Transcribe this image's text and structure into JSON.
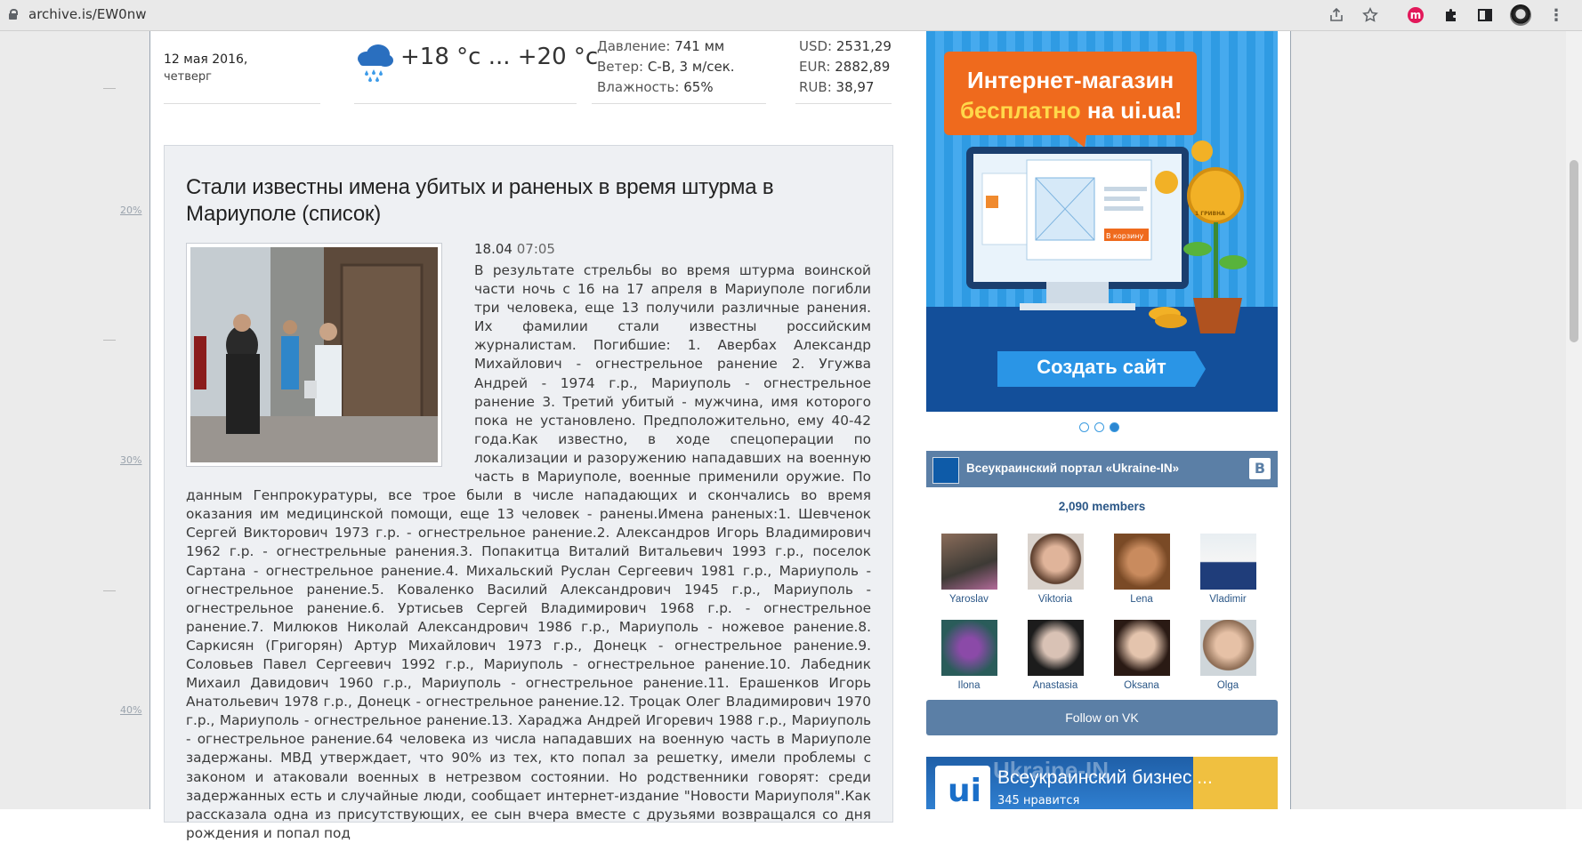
{
  "browser": {
    "url": "archive.is/EW0nw",
    "icons": [
      "share-icon",
      "star-icon",
      "extension-m-icon",
      "puzzle-icon",
      "sidebar-icon",
      "profile-avatar-icon",
      "more-menu-icon"
    ]
  },
  "ruler": {
    "labels": [
      "20%",
      "30%",
      "40%"
    ]
  },
  "header": {
    "date": "12 мая 2016,",
    "weekday": "четверг",
    "temperature": "+18 °с ... +20 °с",
    "weather": [
      {
        "label": "Давление:",
        "value": "741 мм"
      },
      {
        "label": "Ветер:",
        "value": "С-В, 3 м/сек."
      },
      {
        "label": "Влажность:",
        "value": "65%"
      }
    ],
    "currency": [
      {
        "label": "USD:",
        "value": "2531,29"
      },
      {
        "label": "EUR:",
        "value": "2882,89"
      },
      {
        "label": "RUB:",
        "value": "38,97"
      }
    ]
  },
  "article": {
    "title": "Стали известны имена убитых и раненых в время штурма в Мариуполе (список)",
    "date": "18.04",
    "time": "07:05",
    "body": "В результате стрельбы во время штурма воинской части ночь с 16 на 17 апреля в Мариуполе погибли три человека, еще 13 получили различные ранения. Их фамилии стали известны российским журналистам. Погибшие: 1. Авербах Александр Михайлович - огнестрельное ранение 2. Угужва Андрей - 1974 г.р., Мариуполь - огнестрельное ранение 3. Третий убитый - мужчина, имя которого пока не установлено. Предположительно, ему 40-42 года.Как известно, в ходе спецоперации по локализации и разоружению нападавших на военную часть в Мариуполе, военные применили оружие. По данным Генпрокуратуры, все трое были в числе нападающих и скончались во время оказания им медицинской помощи, еще 13 человек - ранены.Имена раненых:1. Шевченок Сергей Викторович 1973 г.р. - огнестрельное ранение.2. Александров Игорь Владимирович 1962 г.р. - огнестрельные ранения.3. Попакитца Виталий Витальевич 1993 г.р., поселок Сартана - огнестрельное ранение.4. Михальский Руслан Сергеевич 1981 г.р., Мариуполь - огнестрельное ранение.5. Коваленко Василий Александрович 1945 г.р., Мариуполь - огнестрельное ранение.6. Уртисьев Сергей Владимирович 1968 г.р. - огнестрельное ранение.7. Милюков Николай Александрович 1986 г.р., Мариуполь - ножевое ранение.8. Саркисян (Григорян) Артур Михайлович 1973 г.р., Донецк - огнестрельное ранение.9. Соловьев Павел Сергеевич 1992 г.р., Мариуполь - огнестрельное ранение.10. Лабедник Михаил Давидович 1960 г.р., Мариуполь - огнестрельное ранение.11. Ерашенков Игорь Анатольевич 1978 г.р., Донецк - огнестрельное ранение.12. Троцак Олег Владимирович 1970 г.р., Мариуполь - огнестрельное ранение.13. Хараджа Андрей Игоревич 1988 г.р., Мариуполь - огнестрельное ранение.64 человека из числа нападавших на военную часть в Мариуполе задержаны. МВД утверждает, что 90% из тех, кто попал за решетку, имели проблемы с законом и атаковали военных в нетрезвом состоянии. Но родственники говорят: среди задержанных есть и случайные люди, сообщает интернет-издание \"Новости Мариуполя\".Как рассказала одна из присутствующих, ее сын вчера вместе с друзьями возвращался со дня рождения и попал под"
  },
  "ad": {
    "headline1": "Интернет-магазин",
    "headline2_a": "бесплатно",
    "headline2_b": " на ui.ua!",
    "cart_label": "В корзину",
    "coin_label": "1 ГРИВНА",
    "button": "Создать сайт",
    "dots": 3,
    "active_dot": 2
  },
  "vk": {
    "group_name": "Всеукраинский портал «Ukraine-IN»",
    "vk_letter": "B",
    "members_count": "2,090 members",
    "members": [
      "Yaroslav",
      "Viktoria",
      "Lena",
      "Vladimir",
      "Ilona",
      "Anastasia",
      "Oksana",
      "Olga"
    ],
    "follow_label": "Follow on VK"
  },
  "fb_widget": {
    "title": "Всеукраинский бизнес ...",
    "likes": "345 нравится",
    "overlay_title": "Ukraine-IN"
  }
}
